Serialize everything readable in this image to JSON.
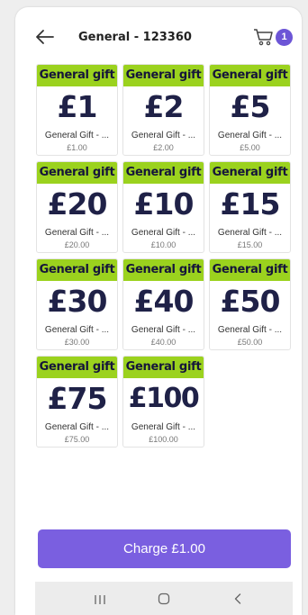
{
  "header": {
    "title": "General - 123360",
    "cart_count": "1"
  },
  "accent_colors": {
    "band": "#9bd21e",
    "primary": "#7a5fe0",
    "badge": "#6c55d6"
  },
  "cards": [
    {
      "band": "General gift",
      "amount": "£1",
      "name": "General Gift - ...",
      "price": "£1.00"
    },
    {
      "band": "General gift",
      "amount": "£2",
      "name": "General Gift - ...",
      "price": "£2.00"
    },
    {
      "band": "General gift",
      "amount": "£5",
      "name": "General Gift - ...",
      "price": "£5.00"
    },
    {
      "band": "General gift",
      "amount": "£20",
      "name": "General Gift - ...",
      "price": "£20.00"
    },
    {
      "band": "General gift",
      "amount": "£10",
      "name": "General Gift - ...",
      "price": "£10.00"
    },
    {
      "band": "General gift",
      "amount": "£15",
      "name": "General Gift - ...",
      "price": "£15.00"
    },
    {
      "band": "General gift",
      "amount": "£30",
      "name": "General Gift - ...",
      "price": "£30.00"
    },
    {
      "band": "General gift",
      "amount": "£40",
      "name": "General Gift - ...",
      "price": "£40.00"
    },
    {
      "band": "General gift",
      "amount": "£50",
      "name": "General Gift - ...",
      "price": "£50.00"
    },
    {
      "band": "General gift",
      "amount": "£75",
      "name": "General Gift - ...",
      "price": "£75.00"
    },
    {
      "band": "General gift",
      "amount": "£100",
      "name": "General Gift - ...",
      "price": "£100.00"
    }
  ],
  "charge_button": {
    "label": "Charge £1.00"
  },
  "icons": {
    "back": "arrow-left-icon",
    "cart": "cart-icon",
    "nav_recent": "recent-apps-icon",
    "nav_home": "home-icon",
    "nav_back": "chevron-left-icon"
  }
}
